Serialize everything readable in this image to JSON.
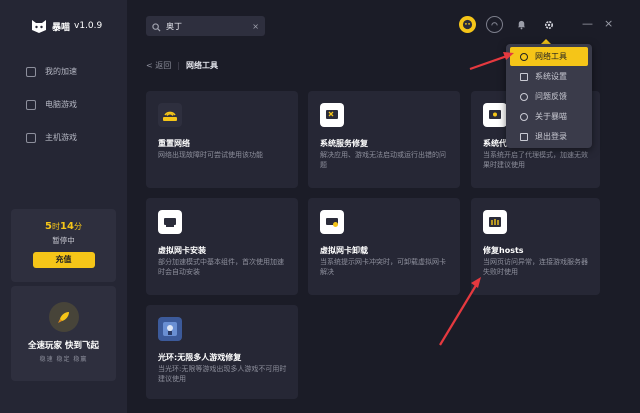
{
  "app": {
    "name": "暴喵",
    "version": "v1.0.9"
  },
  "sidebar": {
    "items": [
      {
        "label": "我的加速",
        "icon": "speed-icon"
      },
      {
        "label": "电脑游戏",
        "icon": "monitor-icon"
      },
      {
        "label": "主机游戏",
        "icon": "console-icon"
      }
    ],
    "timer": {
      "hours": "5",
      "hours_unit": "时",
      "minutes": "14",
      "minutes_unit": "分",
      "status": "暂停中",
      "charge_label": "充值"
    },
    "promo": {
      "title": "全速玩家  快到飞起",
      "subtitle": "稳速  稳定  稳赢"
    }
  },
  "search": {
    "value": "奥丁",
    "clear_glyph": "×"
  },
  "breadcrumb": {
    "back": "返回",
    "title": "网络工具"
  },
  "cards": [
    {
      "title": "重置网络",
      "desc": "网络出现故障时可尝试使用该功能",
      "icon": "wifi-icon",
      "icon_color": "#f5c518"
    },
    {
      "title": "系统服务修复",
      "desc": "解决应用、游戏无法启动或运行出错的问题",
      "icon": "tools-icon",
      "icon_color": "#2b2c3a"
    },
    {
      "title": "系统代",
      "desc": "当系统开启了代理模式，加速无效果时建议使用",
      "icon": "proxy-icon",
      "icon_color": "#2b2c3a"
    },
    {
      "title": "虚拟网卡安装",
      "desc": "部分加速模式中基本组件，首次使用加速时会自动安装",
      "icon": "network-card-icon",
      "icon_color": "#2b2c3a"
    },
    {
      "title": "虚拟网卡卸载",
      "desc": "当系统提示网卡冲突时，可卸载虚拟网卡解决",
      "icon": "network-card-remove-icon",
      "icon_color": "#2b2c3a"
    },
    {
      "title": "修复hosts",
      "desc": "当网页访问异常，连接游戏服务器失败时使用",
      "icon": "hosts-repair-icon",
      "icon_color": "#f5c518"
    },
    {
      "title": "光环:无限多人游戏修复",
      "desc": "当光环:无限等游戏出现多人游戏不可用时建议使用",
      "icon": "halo-game-icon",
      "icon_color": "#4a6cb0"
    }
  ],
  "menu": {
    "items": [
      {
        "label": "网络工具",
        "active": true,
        "icon": "globe-icon"
      },
      {
        "label": "系统设置",
        "active": false,
        "icon": "sliders-icon"
      },
      {
        "label": "问题反馈",
        "active": false,
        "icon": "feedback-icon"
      },
      {
        "label": "关于暴喵",
        "active": false,
        "icon": "info-icon"
      },
      {
        "label": "退出登录",
        "active": false,
        "icon": "logout-icon"
      }
    ]
  },
  "window": {
    "minimize": "—",
    "close": "×"
  },
  "colors": {
    "accent": "#f5c518",
    "annotation_arrow": "#e5393f"
  }
}
